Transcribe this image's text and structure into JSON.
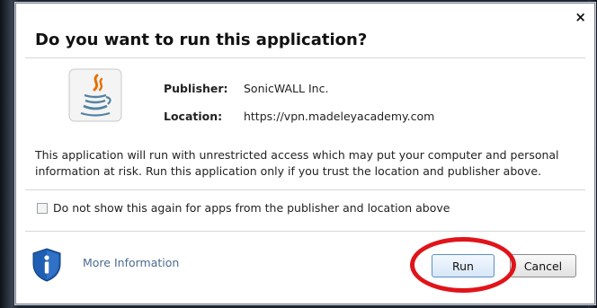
{
  "dialog": {
    "title": "Do you want to run this application?",
    "close_glyph": "×",
    "publisher_label": "Publisher:",
    "publisher_value": "SonicWALL Inc.",
    "location_label": "Location:",
    "location_value": "https://vpn.madeleyacademy.com",
    "warning_line1": "This application will run with unrestricted access which may put your computer and personal",
    "warning_line2": "information at risk. Run this application only if you trust the location and publisher above.",
    "checkbox_label": "Do not show this again for apps from the publisher and location above",
    "checkbox_checked": false,
    "more_info_label": "More Information",
    "run_label": "Run",
    "cancel_label": "Cancel"
  },
  "icons": {
    "app_icon": "java-coffee-cup-icon",
    "info_icon": "shield-info-icon"
  },
  "colors": {
    "highlight_ring": "#e0141a",
    "link": "#4b6a91",
    "java_red": "#e76f00",
    "java_blue": "#5382a1",
    "shield_blue": "#1f5fb3"
  }
}
